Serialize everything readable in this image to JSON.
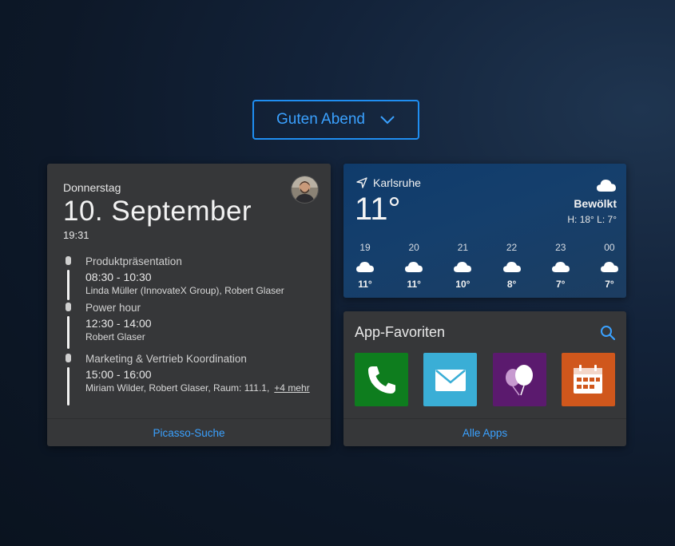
{
  "greeting": {
    "label": "Guten Abend"
  },
  "calendar": {
    "weekday": "Donnerstag",
    "date": "10. September",
    "time": "19:31",
    "events": [
      {
        "title": "Produktpräsentation",
        "time": "08:30 - 10:30",
        "people": "Linda Müller (InnovateX Group), Robert Glaser"
      },
      {
        "title": "Power hour",
        "time": "12:30 - 14:00",
        "people": "Robert Glaser"
      },
      {
        "title": "Marketing & Vertrieb Koordination",
        "time": "15:00 - 16:00",
        "people": "Miriam Wilder, Robert Glaser, Raum: 111.1,",
        "more": "+4 mehr"
      }
    ],
    "footer": "Picasso-Suche"
  },
  "weather": {
    "location": "Karlsruhe",
    "temperature": "11°",
    "condition": "Bewölkt",
    "high_low": "H: 18° L: 7°",
    "icon": "cloud-icon",
    "hourly": [
      {
        "hour": "19",
        "temp": "11°"
      },
      {
        "hour": "20",
        "temp": "11°"
      },
      {
        "hour": "21",
        "temp": "10°"
      },
      {
        "hour": "22",
        "temp": "8°"
      },
      {
        "hour": "23",
        "temp": "7°"
      },
      {
        "hour": "00",
        "temp": "7°"
      }
    ]
  },
  "apps": {
    "title": "App-Favoriten",
    "items": [
      {
        "icon": "phone-icon",
        "color": "#0e7d1e"
      },
      {
        "icon": "mail-icon",
        "color": "#3aaed6"
      },
      {
        "icon": "balloons-icon",
        "color": "#5b1a6e"
      },
      {
        "icon": "calendar-icon",
        "color": "#d0571c"
      }
    ],
    "footer": "Alle Apps"
  },
  "colors": {
    "accent": "#3aa1ff",
    "card": "#363739"
  }
}
